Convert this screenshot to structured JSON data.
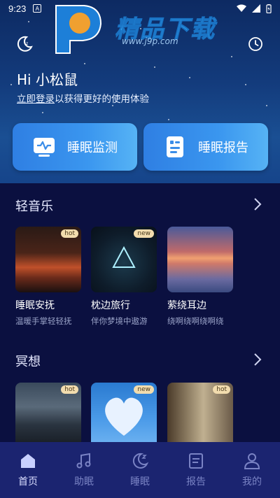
{
  "status_bar": {
    "time": "9:23",
    "app_indicator": "A"
  },
  "watermark": {
    "title": "精品下载",
    "url": "www.j9p.com"
  },
  "header": {
    "greeting": "Hi 小松鼠",
    "login_prefix": "立即登录",
    "login_suffix": "以获得更好的使用体验"
  },
  "features": [
    {
      "label": "睡眠监测",
      "icon": "monitor-pulse-icon"
    },
    {
      "label": "睡眠报告",
      "icon": "report-icon"
    }
  ],
  "sections": {
    "light_music": {
      "title": "轻音乐",
      "cards": [
        {
          "title": "睡眠安抚",
          "subtitle": "温暖手掌轻轻抚",
          "badge": "hot"
        },
        {
          "title": "枕边旅行",
          "subtitle": "伴你梦境中遨游",
          "badge": "new"
        },
        {
          "title": "萦绕耳边",
          "subtitle": "绕啊绕啊绕啊绕",
          "badge": ""
        }
      ]
    },
    "meditation": {
      "title": "冥想",
      "cards": [
        {
          "badge": "hot"
        },
        {
          "badge": "new"
        },
        {
          "badge": "hot"
        }
      ]
    }
  },
  "tabs": [
    {
      "label": "首页",
      "icon": "home-icon",
      "active": true
    },
    {
      "label": "助眠",
      "icon": "music-note-icon",
      "active": false
    },
    {
      "label": "睡眠",
      "icon": "moon-sleep-icon",
      "active": false
    },
    {
      "label": "报告",
      "icon": "report-icon",
      "active": false
    },
    {
      "label": "我的",
      "icon": "user-icon",
      "active": false
    }
  ],
  "colors": {
    "background": "#0b1040",
    "accent_blue": "#3a96ef",
    "tabbar": "#1b2470",
    "badge": "#f2dcae"
  }
}
